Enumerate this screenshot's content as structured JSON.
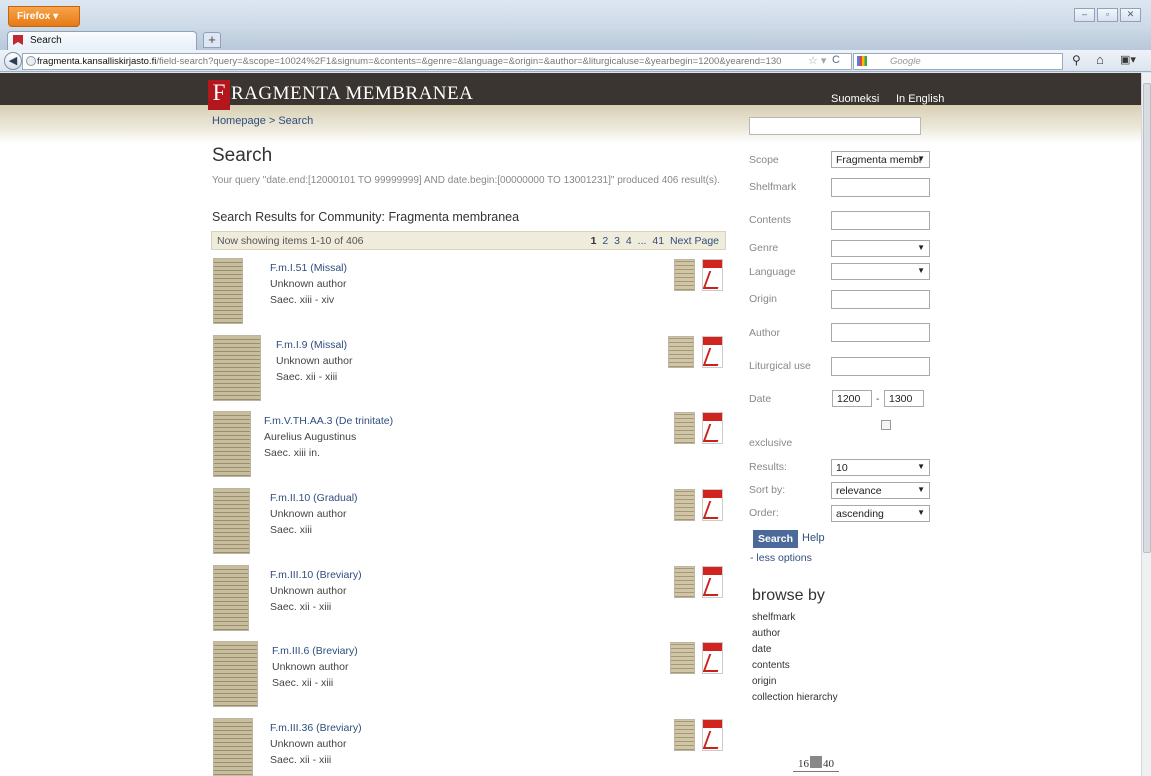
{
  "browser": {
    "menu_button": "Firefox",
    "tab_title": "Search",
    "new_tab": "+",
    "url_host": "fragmenta.kansalliskirjasto.fi",
    "url_path": "/field-search?query=&scope=10024%2F1&signum=&contents=&genre=&language=&origin=&author=&liturgicaluse=&yearbegin=1200&yearend=130",
    "search_engine_placeholder": "Google"
  },
  "header": {
    "logo_letter": "F",
    "logo_text": "RAGMENTA MEMBRANEA",
    "lang_fi": "Suomeksi",
    "lang_en": "In English"
  },
  "breadcrumb": "Homepage >  Search",
  "page_title": "Search",
  "query_text": "Your query \"date.end:[12000101 TO 99999999] AND date.begin:[00000000 TO 13001231]\" produced 406 result(s).",
  "results_heading": "Search Results for Community: Fragmenta membranea",
  "pager": {
    "showing": "Now showing items 1-10 of 406",
    "pages": [
      "1",
      "2",
      "3",
      "4",
      "...",
      "41",
      "Next Page"
    ]
  },
  "results": [
    {
      "title": "F.m.I.51 (Missal)",
      "author": "Unknown author",
      "date": "Saec. xiii - xiv"
    },
    {
      "title": "F.m.I.9 (Missal)",
      "author": "Unknown author",
      "date": "Saec. xii - xiii"
    },
    {
      "title": "F.m.V.TH.AA.3 (De trinitate)",
      "author": "Aurelius Augustinus",
      "date": "Saec. xiii in."
    },
    {
      "title": "F.m.II.10 (Gradual)",
      "author": "Unknown author",
      "date": "Saec. xiii"
    },
    {
      "title": "F.m.III.10 (Breviary)",
      "author": "Unknown author",
      "date": "Saec. xii - xiii"
    },
    {
      "title": "F.m.III.6 (Breviary)",
      "author": "Unknown author",
      "date": "Saec. xii - xiii"
    },
    {
      "title": "F.m.III.36 (Breviary)",
      "author": "Unknown author",
      "date": "Saec. xii - xiii"
    }
  ],
  "sidebar": {
    "scope_label": "Scope",
    "scope_value": "Fragmenta membr",
    "shelfmark_label": "Shelfmark",
    "contents_label": "Contents",
    "genre_label": "Genre",
    "language_label": "Language",
    "origin_label": "Origin",
    "author_label": "Author",
    "liturgical_label": "Liturgical use",
    "date_label": "Date",
    "date_begin": "1200",
    "date_dash": "-",
    "date_end": "1300",
    "exclusive_label": "exclusive",
    "results_label": "Results:",
    "results_value": "10",
    "sort_label": "Sort by:",
    "sort_value": "relevance",
    "order_label": "Order:",
    "order_value": "ascending",
    "search_button": "Search",
    "help_link": "Help",
    "less_options": "- less options"
  },
  "browse": {
    "title": "browse by",
    "links": [
      "shelfmark",
      "author",
      "date",
      "contents",
      "origin",
      "collection hierarchy"
    ]
  },
  "footer_logo": {
    "left": "16",
    "right": "40"
  }
}
